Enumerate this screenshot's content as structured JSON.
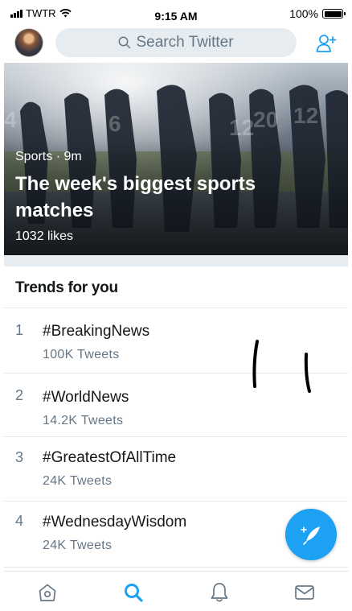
{
  "status_bar": {
    "carrier": "TWTR",
    "time": "9:15 AM",
    "battery": "100%",
    "icons": [
      "signal-bars-icon",
      "wifi-icon",
      "battery-icon"
    ]
  },
  "header": {
    "search_placeholder": "Search Twitter",
    "icons": [
      "search-icon",
      "add-user-icon"
    ]
  },
  "hero": {
    "meta": "Sports · 9m",
    "title": "The week's biggest sports matches",
    "likes": "1032 likes"
  },
  "trends": {
    "heading": "Trends for you",
    "items": [
      {
        "rank": "1",
        "tag": "#BreakingNews",
        "count": "100K Tweets"
      },
      {
        "rank": "2",
        "tag": "#WorldNews",
        "count": "14.2K Tweets"
      },
      {
        "rank": "3",
        "tag": "#GreatestOfAllTime",
        "count": "24K Tweets"
      },
      {
        "rank": "4",
        "tag": "#WednesdayWisdom",
        "count": "24K Tweets"
      }
    ]
  },
  "tabs": [
    "home-icon",
    "search-icon",
    "notifications-icon",
    "messages-icon"
  ],
  "active_tab": "search",
  "compose": {
    "icon": "compose-feather-icon"
  },
  "colors": {
    "accent": "#1da1f2",
    "secondary_text": "#657786",
    "divider": "#e1e8ed"
  }
}
